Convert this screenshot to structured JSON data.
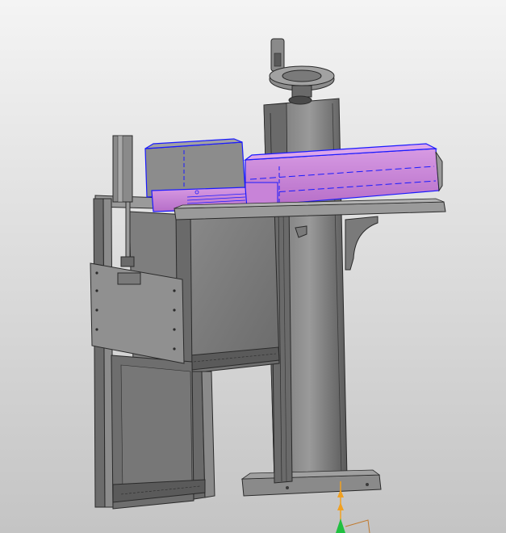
{
  "viewport": {
    "background_top": "#f4f4f4",
    "background_bottom": "#c4c4c4"
  },
  "model": {
    "body_color": "#7a7a7a",
    "body_shade": "#5b5b5b",
    "highlight_fill": "#c77fd6",
    "highlight_edge": "#1a1aff",
    "edge_color": "#2a2a2a",
    "parts": [
      "handwheel",
      "vertical-column",
      "base-plate",
      "aluminum-frame",
      "side-panel",
      "cylinder",
      "control-box",
      "laser-module",
      "support-arm",
      "bracket"
    ],
    "highlighted_parts": [
      "control-box",
      "laser-module"
    ]
  },
  "triad": {
    "z_axis_color": "#f0a020",
    "origin_color": "#20c040",
    "frame_color": "#c07a30"
  }
}
